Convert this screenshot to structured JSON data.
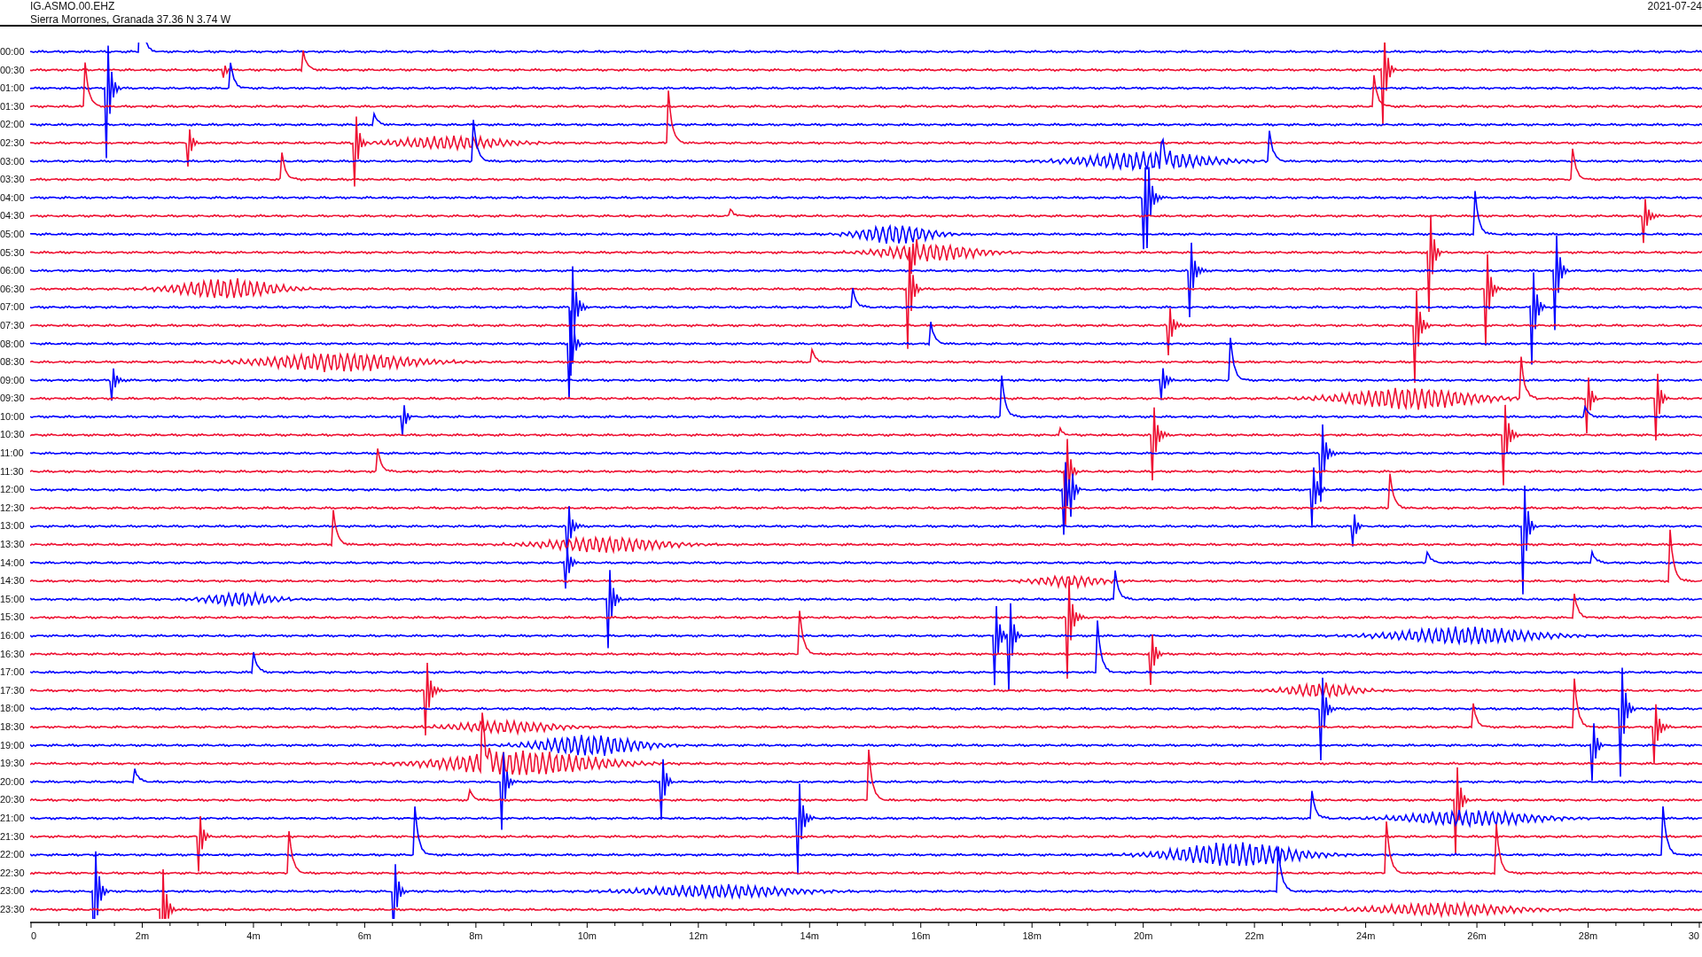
{
  "header": {
    "station": "IG.ASMO.00.EHZ",
    "location": "Sierra Morrones, Granada  37.36 N 3.74 W",
    "date": "2021-07-24"
  },
  "rows": [
    {
      "time": "00:00",
      "color": "#0000ff"
    },
    {
      "time": "00:30",
      "color": "#ee1133"
    },
    {
      "time": "01:00",
      "color": "#0000ff"
    },
    {
      "time": "01:30",
      "color": "#ee1133"
    },
    {
      "time": "02:00",
      "color": "#0000ff"
    },
    {
      "time": "02:30",
      "color": "#ee1133"
    },
    {
      "time": "03:00",
      "color": "#0000ff"
    },
    {
      "time": "03:30",
      "color": "#ee1133"
    },
    {
      "time": "04:00",
      "color": "#0000ff"
    },
    {
      "time": "04:30",
      "color": "#ee1133"
    },
    {
      "time": "05:00",
      "color": "#0000ff"
    },
    {
      "time": "05:30",
      "color": "#ee1133"
    },
    {
      "time": "06:00",
      "color": "#0000ff"
    },
    {
      "time": "06:30",
      "color": "#ee1133"
    },
    {
      "time": "07:00",
      "color": "#0000ff"
    },
    {
      "time": "07:30",
      "color": "#ee1133"
    },
    {
      "time": "08:00",
      "color": "#0000ff"
    },
    {
      "time": "08:30",
      "color": "#ee1133"
    },
    {
      "time": "09:00",
      "color": "#0000ff"
    },
    {
      "time": "09:30",
      "color": "#ee1133"
    },
    {
      "time": "10:00",
      "color": "#0000ff"
    },
    {
      "time": "10:30",
      "color": "#ee1133"
    },
    {
      "time": "11:00",
      "color": "#0000ff"
    },
    {
      "time": "11:30",
      "color": "#ee1133"
    },
    {
      "time": "12:00",
      "color": "#0000ff"
    },
    {
      "time": "12:30",
      "color": "#ee1133"
    },
    {
      "time": "13:00",
      "color": "#0000ff"
    },
    {
      "time": "13:30",
      "color": "#ee1133"
    },
    {
      "time": "14:00",
      "color": "#0000ff"
    },
    {
      "time": "14:30",
      "color": "#ee1133"
    },
    {
      "time": "15:00",
      "color": "#0000ff"
    },
    {
      "time": "15:30",
      "color": "#ee1133"
    },
    {
      "time": "16:00",
      "color": "#0000ff"
    },
    {
      "time": "16:30",
      "color": "#ee1133"
    },
    {
      "time": "17:00",
      "color": "#0000ff"
    },
    {
      "time": "17:30",
      "color": "#ee1133"
    },
    {
      "time": "18:00",
      "color": "#0000ff"
    },
    {
      "time": "18:30",
      "color": "#ee1133"
    },
    {
      "time": "19:00",
      "color": "#0000ff"
    },
    {
      "time": "19:30",
      "color": "#ee1133"
    },
    {
      "time": "20:00",
      "color": "#0000ff"
    },
    {
      "time": "20:30",
      "color": "#ee1133"
    },
    {
      "time": "21:00",
      "color": "#0000ff"
    },
    {
      "time": "21:30",
      "color": "#ee1133"
    },
    {
      "time": "22:00",
      "color": "#0000ff"
    },
    {
      "time": "22:30",
      "color": "#ee1133"
    },
    {
      "time": "23:00",
      "color": "#0000ff"
    },
    {
      "time": "23:30",
      "color": "#ee1133"
    }
  ],
  "x_axis_labels": [
    "0",
    "2m",
    "4m",
    "6m",
    "8m",
    "10m",
    "12m",
    "14m",
    "16m",
    "18m",
    "20m",
    "22m",
    "24m",
    "26m",
    "28m",
    "30"
  ]
}
